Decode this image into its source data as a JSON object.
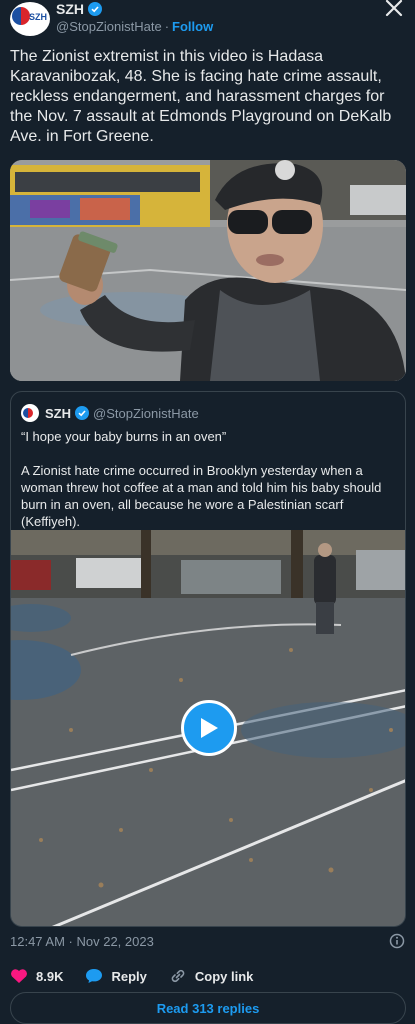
{
  "author": {
    "name": "SZH",
    "handle": "@StopZionistHate",
    "separator": "·",
    "follow_label": "Follow",
    "avatar_abbr": "SZH"
  },
  "tweet": {
    "text": "The Zionist extremist in this video is Hadasa Karavanibozak, 48. She is facing hate crime assault, reckless endangerment, and harassment charges for the Nov. 7 assault at Edmonds Playground on DeKalb Ave. in Fort Greene."
  },
  "quoted": {
    "name": "SZH",
    "handle": "@StopZionistHate",
    "line1": "“I hope your baby burns in an oven”",
    "line2": "A Zionist hate crime occurred in Brooklyn yesterday when a woman threw hot coffee at a man and told him his baby should burn in an oven, all because he wore a Palestinian scarf (Keffiyeh)."
  },
  "meta": {
    "timestamp": "12:47 AM · Nov 22, 2023"
  },
  "actions": {
    "likes": "8.9K",
    "reply_label": "Reply",
    "copy_label": "Copy link"
  },
  "replies_button": "Read 313 replies",
  "colors": {
    "background": "#15202b",
    "accent": "#1d9bf0",
    "like": "#f91880",
    "muted": "#8b98a5"
  },
  "icons": [
    "verified-badge-icon",
    "close-icon",
    "play-icon",
    "info-icon",
    "heart-icon",
    "reply-bubble-icon",
    "link-icon"
  ]
}
